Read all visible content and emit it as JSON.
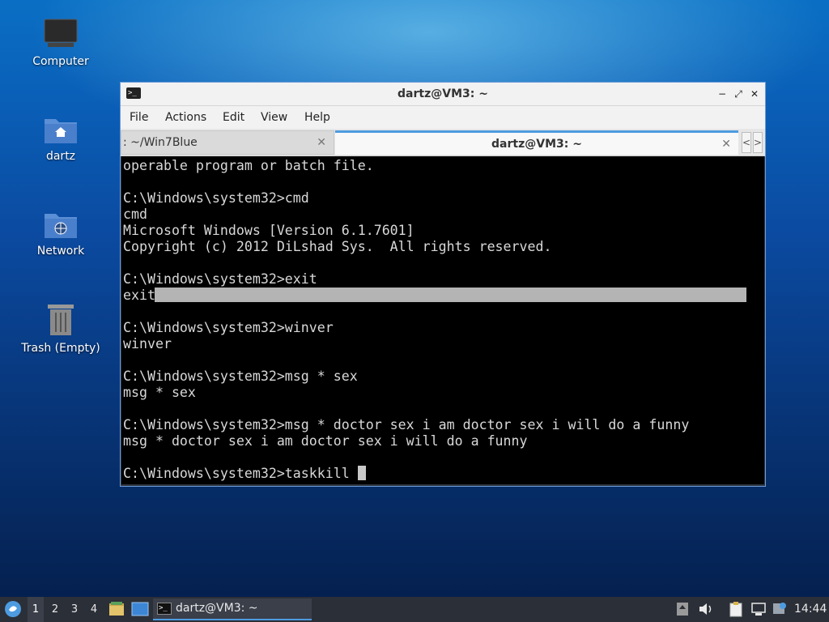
{
  "desktop": {
    "icons": [
      {
        "label": "Computer",
        "icon": "monitor-icon"
      },
      {
        "label": "dartz",
        "icon": "home-folder-icon"
      },
      {
        "label": "Network",
        "icon": "network-folder-icon"
      },
      {
        "label": "Trash (Empty)",
        "icon": "trash-icon"
      }
    ]
  },
  "window": {
    "title": "dartz@VM3: ~",
    "controls": {
      "minimize": "−",
      "restore": "⤢",
      "close": "✕"
    },
    "menu": [
      "File",
      "Actions",
      "Edit",
      "View",
      "Help"
    ],
    "tabs": [
      {
        "label": ": ~/Win7Blue",
        "close": "✕"
      },
      {
        "label": "dartz@VM3: ~",
        "close": "✕"
      }
    ],
    "tab_scroll": {
      "left": "<",
      "right": ">"
    }
  },
  "terminal": {
    "lines": [
      "operable program or batch file.",
      "",
      "C:\\Windows\\system32>cmd",
      "cmd",
      "Microsoft Windows [Version 6.1.7601]",
      "Copyright (c) 2012 DiLshad Sys.  All rights reserved.",
      "",
      "C:\\Windows\\system32>exit",
      "exit",
      "",
      "C:\\Windows\\system32>winver",
      "winver",
      "",
      "C:\\Windows\\system32>msg * sex",
      "msg * sex",
      "",
      "C:\\Windows\\system32>msg * doctor sex i am doctor sex i will do a funny",
      "msg * doctor sex i am doctor sex i will do a funny",
      "",
      "C:\\Windows\\system32>taskkill "
    ]
  },
  "taskbar": {
    "workspaces": [
      "1",
      "2",
      "3",
      "4"
    ],
    "current_workspace": "1",
    "task": {
      "label": "dartz@VM3: ~"
    },
    "clock": "14:44"
  },
  "colors": {
    "accent": "#4d9be0",
    "terminal_bg": "#000000",
    "terminal_fg": "#d8d8d8",
    "taskbar": "#2b2f38"
  }
}
